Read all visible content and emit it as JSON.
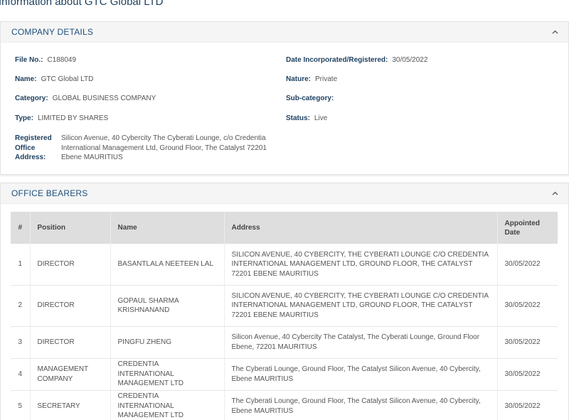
{
  "page": {
    "title": "Information about GTC Global LTD"
  },
  "company_details": {
    "header": "COMPANY DETAILS",
    "file_no": {
      "label": "File No.:",
      "value": "C188049"
    },
    "name": {
      "label": "Name:",
      "value": "GTC Global LTD"
    },
    "category": {
      "label": "Category:",
      "value": "GLOBAL BUSINESS COMPANY"
    },
    "type": {
      "label": "Type:",
      "value": "LIMITED BY SHARES"
    },
    "address": {
      "label": "Registered Office Address:",
      "value": "Silicon Avenue, 40 Cybercity The Cyberati Lounge, c/o Credentia International Management Ltd, Ground Floor, The Catalyst 72201 Ebene MAURITIUS"
    },
    "date_incorporated": {
      "label": "Date Incorporated/Registered:",
      "value": "30/05/2022"
    },
    "nature": {
      "label": "Nature:",
      "value": "Private"
    },
    "sub_category": {
      "label": "Sub-category:",
      "value": ""
    },
    "status": {
      "label": "Status:",
      "value": "Live"
    }
  },
  "office_bearers": {
    "header": "OFFICE BEARERS",
    "columns": [
      "#",
      "Position",
      "Name",
      "Address",
      "Appointed Date"
    ],
    "rows": [
      {
        "num": "1",
        "position": "DIRECTOR",
        "name": "BASANTLALA NEETEEN LAL",
        "address": "SILICON AVENUE, 40 CYBERCITY, THE CYBERATI LOUNGE C/O CREDENTIA INTERNATIONAL MANAGEMENT LTD, GROUND FLOOR, THE CATALYST 72201 EBENE MAURITIUS",
        "date": "30/05/2022"
      },
      {
        "num": "2",
        "position": "DIRECTOR",
        "name": "GOPAUL SHARMA KRISHNANAND",
        "address": "SILICON AVENUE, 40 CYBERCITY, THE CYBERATI LOUNGE C/O CREDENTIA INTERNATIONAL MANAGEMENT LTD, GROUND FLOOR, THE CATALYST 72201 EBENE MAURITIUS",
        "date": "30/05/2022"
      },
      {
        "num": "3",
        "position": "DIRECTOR",
        "name": "PINGFU ZHENG",
        "address": "Silicon Avenue, 40 Cybercity The Catalyst, The Cyberati Lounge, Ground Floor Ebene, 72201 MAURITIUS",
        "date": "30/05/2022"
      },
      {
        "num": "4",
        "position": "MANAGEMENT COMPANY",
        "name": "CREDENTIA INTERNATIONAL MANAGEMENT LTD",
        "address": "The Cyberati Lounge, Ground Floor, The Catalyst Silicon Avenue, 40 Cybercity, Ebene MAURITIUS",
        "date": "30/05/2022"
      },
      {
        "num": "5",
        "position": "SECRETARY",
        "name": "CREDENTIA INTERNATIONAL MANAGEMENT LTD",
        "address": "The Cyberati Lounge, Ground Floor, The Catalyst Silicon Avenue, 40 Cybercity, Ebene MAURITIUS",
        "date": "30/05/2022"
      }
    ]
  },
  "icons": {
    "collapse": "chevron-up-icon"
  },
  "colors": {
    "heading": "#1d4f7c",
    "label": "#1d3f5e",
    "table_header_bg": "#dedede",
    "panel_header_bg": "#f5f5f5"
  }
}
